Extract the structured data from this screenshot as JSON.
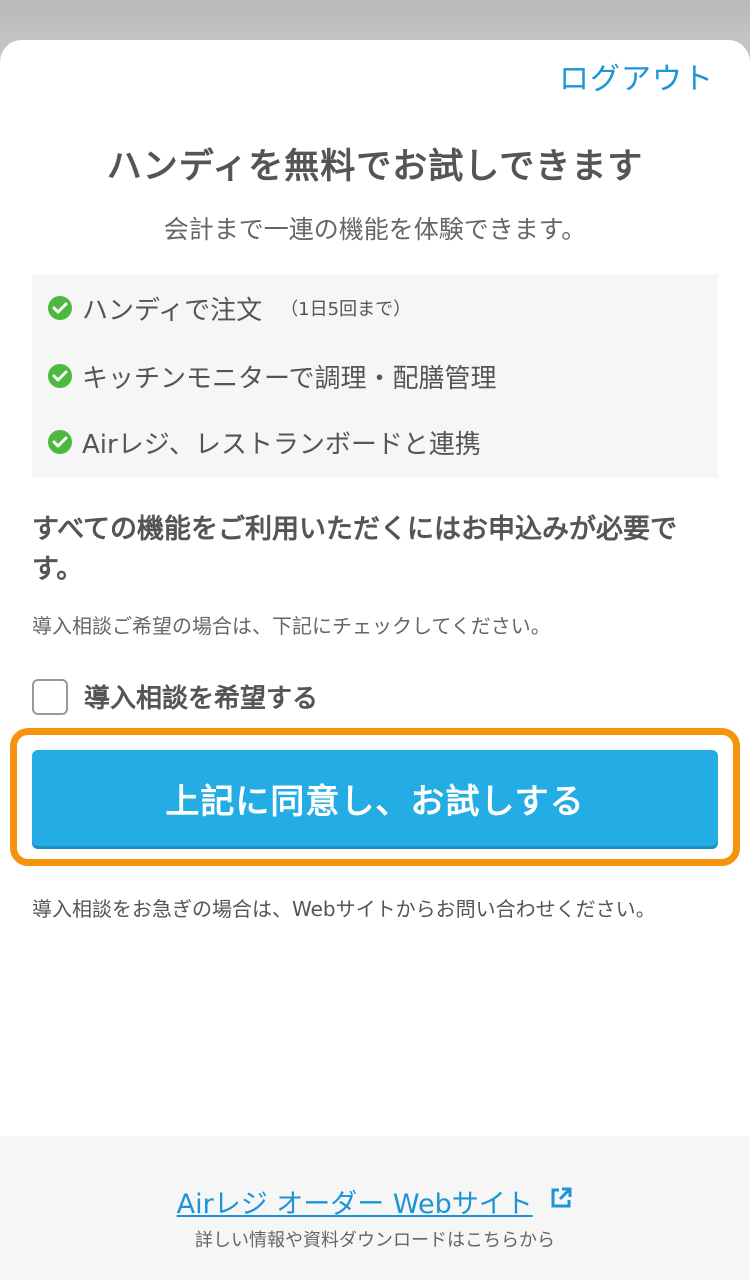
{
  "header": {
    "logout_label": "ログアウト"
  },
  "intro": {
    "title": "ハンディを無料でお試しできます",
    "subtitle": "会計まで一連の機能を体験できます。"
  },
  "features": [
    {
      "label": "ハンディで注文",
      "note": "（1日5回まで）",
      "icon": "check-circle-icon"
    },
    {
      "label": "キッチンモニターで調理・配膳管理",
      "note": "",
      "icon": "check-circle-icon"
    },
    {
      "label": "Airレジ、レストランボードと連携",
      "note": "",
      "icon": "check-circle-icon"
    }
  ],
  "notice": "すべての機能をご利用いただくにはお申込みが必要です。",
  "hint": "導入相談ご希望の場合は、下記にチェックしてください。",
  "consult_checkbox": {
    "label": "導入相談を希望する",
    "checked": false
  },
  "primary_button": {
    "label": "上記に同意し、お試しする"
  },
  "info": "導入相談をお急ぎの場合は、Webサイトからお問い合わせください。",
  "footer": {
    "link_label": "Airレジ オーダー Webサイト",
    "caption": "詳しい情報や資料ダウンロードはこちらから"
  },
  "colors": {
    "accent": "#1b95d6",
    "button": "#23ade4",
    "highlight": "#f5930f",
    "check": "#4cb83f"
  }
}
